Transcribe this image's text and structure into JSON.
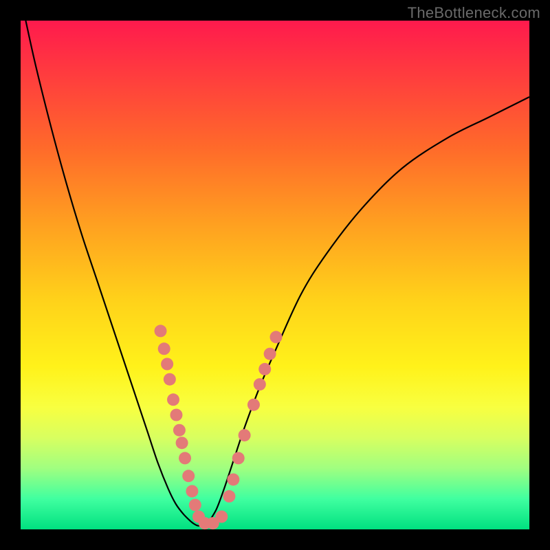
{
  "watermark": {
    "text": "TheBottleneck.com"
  },
  "chart_data": {
    "type": "line",
    "title": "",
    "xlabel": "",
    "ylabel": "",
    "xlim": [
      0,
      100
    ],
    "ylim": [
      0,
      100
    ],
    "grid": false,
    "legend": false,
    "series": [
      {
        "name": "left-curve",
        "x": [
          1,
          3,
          6,
          9,
          12,
          15,
          18,
          21,
          23,
          25,
          27,
          29,
          30.5,
          32,
          33.5
        ],
        "y": [
          100,
          91,
          79,
          68,
          58,
          49,
          40,
          31,
          25,
          19,
          13,
          8,
          5,
          3,
          1.5
        ]
      },
      {
        "name": "right-curve",
        "x": [
          37,
          38.5,
          40,
          42,
          44,
          47,
          50,
          55,
          60,
          67,
          75,
          84,
          92,
          100
        ],
        "y": [
          1.5,
          4,
          8,
          14,
          20,
          28,
          35,
          46,
          54,
          63,
          71,
          77,
          81,
          85
        ]
      },
      {
        "name": "valley-floor",
        "x": [
          33.5,
          35,
          37
        ],
        "y": [
          1.5,
          0.7,
          1.5
        ]
      }
    ],
    "markers": {
      "name": "highlight-dots",
      "color": "#e37a78",
      "radius_px": 9,
      "points": [
        {
          "x": 27.5,
          "y": 39
        },
        {
          "x": 28.2,
          "y": 35.5
        },
        {
          "x": 28.8,
          "y": 32.5
        },
        {
          "x": 29.3,
          "y": 29.5
        },
        {
          "x": 30.0,
          "y": 25.5
        },
        {
          "x": 30.6,
          "y": 22.5
        },
        {
          "x": 31.2,
          "y": 19.5
        },
        {
          "x": 31.7,
          "y": 17
        },
        {
          "x": 32.3,
          "y": 14
        },
        {
          "x": 33.0,
          "y": 10.5
        },
        {
          "x": 33.7,
          "y": 7.5
        },
        {
          "x": 34.3,
          "y": 4.8
        },
        {
          "x": 35.0,
          "y": 2.5
        },
        {
          "x": 36.2,
          "y": 1.2
        },
        {
          "x": 37.8,
          "y": 1.2
        },
        {
          "x": 39.5,
          "y": 2.5
        },
        {
          "x": 41.0,
          "y": 6.5
        },
        {
          "x": 41.8,
          "y": 9.8
        },
        {
          "x": 42.8,
          "y": 14.0
        },
        {
          "x": 44.0,
          "y": 18.5
        },
        {
          "x": 45.8,
          "y": 24.5
        },
        {
          "x": 47.0,
          "y": 28.5
        },
        {
          "x": 48.0,
          "y": 31.5
        },
        {
          "x": 49.0,
          "y": 34.5
        },
        {
          "x": 50.2,
          "y": 37.8
        }
      ]
    }
  }
}
